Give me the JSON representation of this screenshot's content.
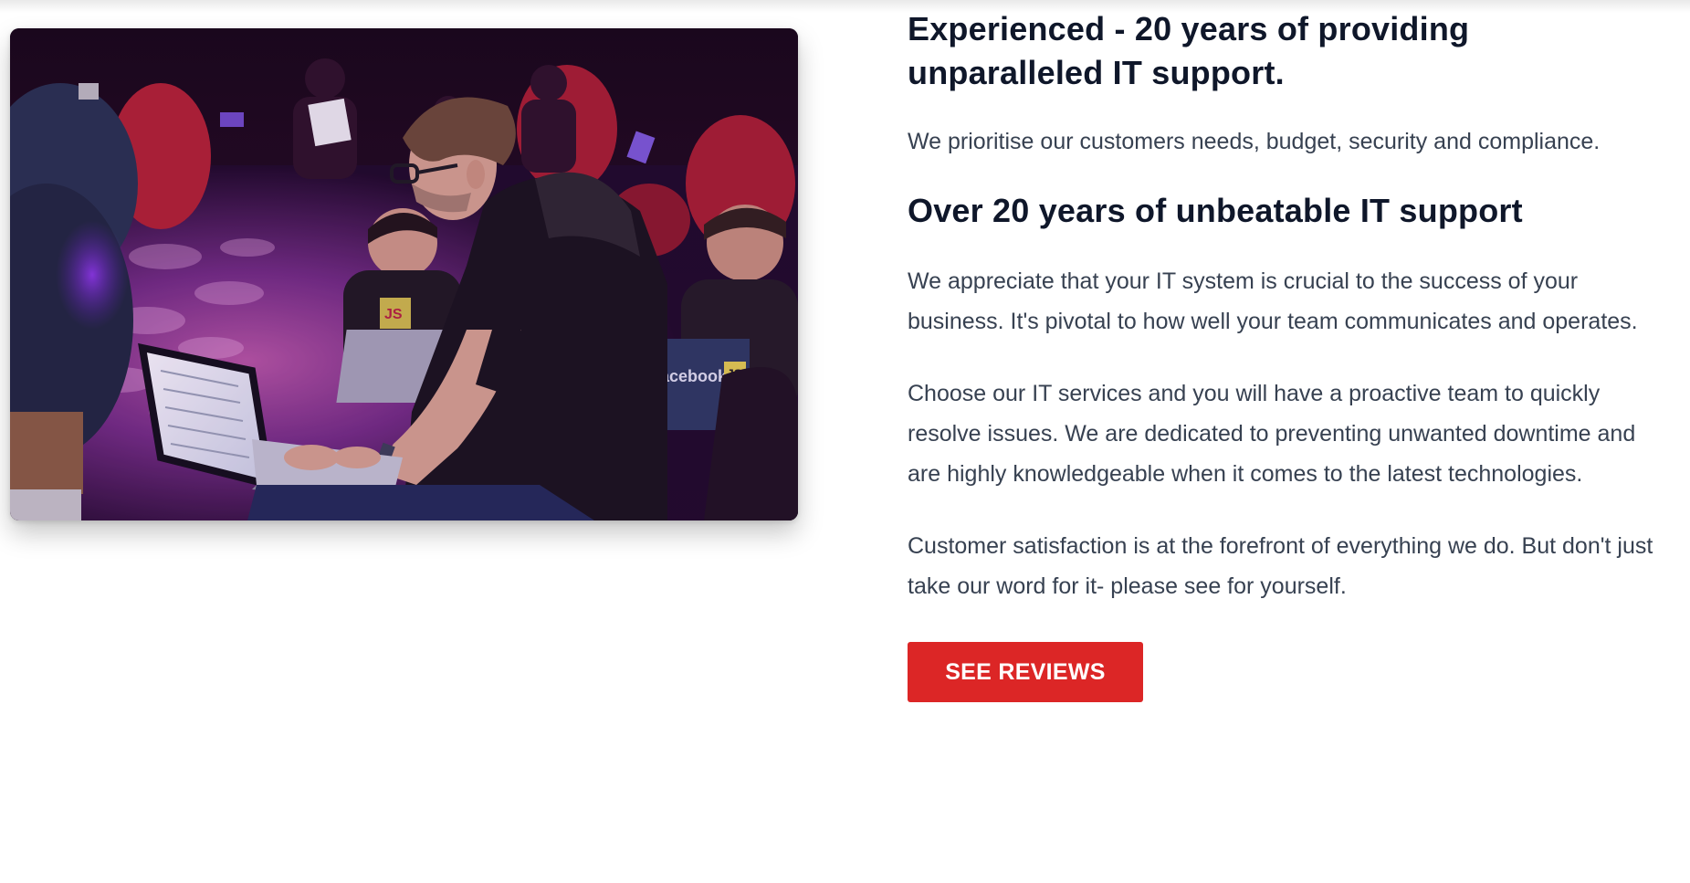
{
  "feature": {
    "headline": "Experienced - 20 years of providing unparalleled IT support.",
    "intro": "We prioritise our customers needs, budget, security and compliance.",
    "subheadline": "Over 20 years of unbeatable IT support",
    "paragraphs": [
      "We appreciate that your IT system is crucial to the success of your business. It's pivotal to how well your team communicates and operates.",
      "Choose our IT services and you will have a proactive team to quickly resolve issues. We are dedicated to preventing unwanted downtime and are highly knowledgeable when it comes to the latest technologies.",
      "Customer satisfaction is at the forefront of everything we do. But don't just take our word for it- please see for yourself."
    ],
    "cta_label": "SEE REVIEWS",
    "accent_color": "#dc2626"
  },
  "photo": {
    "subject": "developers-working-on-laptops-photo",
    "laptop_sticker_text": "acebook",
    "laptop_sticker_badge": "JS",
    "shirt_badge": "JS"
  }
}
